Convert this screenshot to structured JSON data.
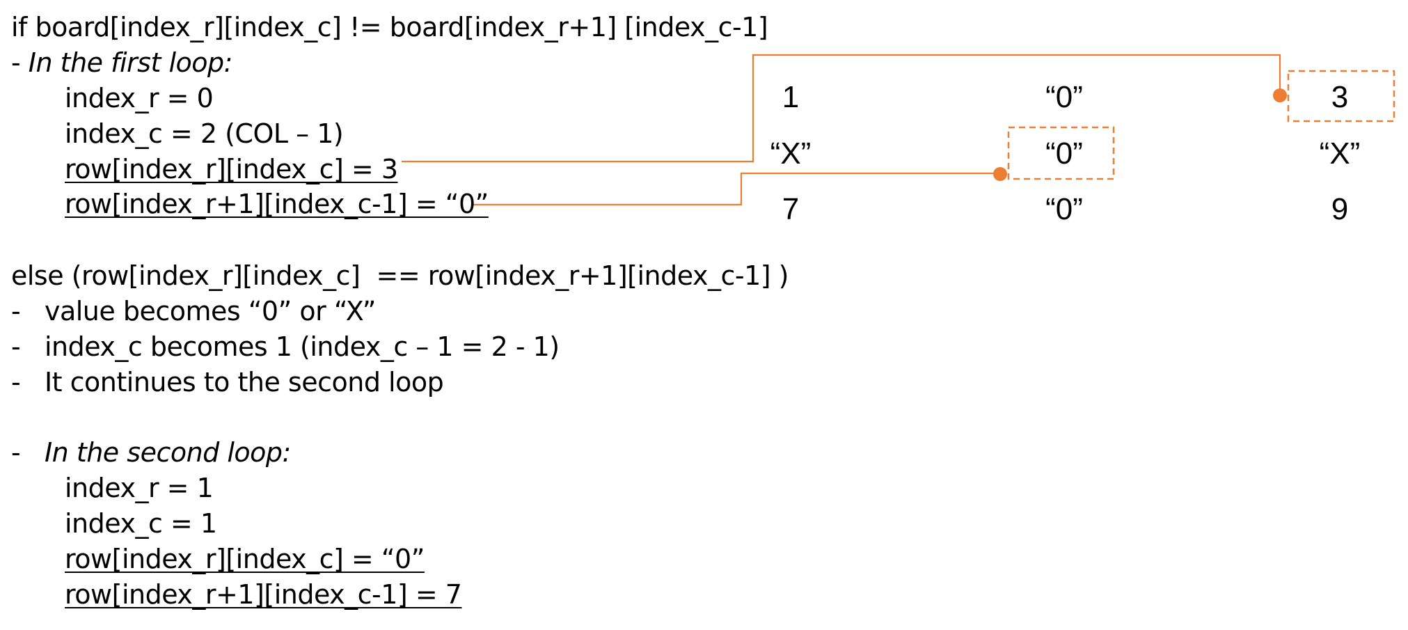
{
  "lines": {
    "cond_if": "if board[index_r][index_c] != board[index_r+1] [index_c-1]",
    "first_loop_dash": "- ",
    "first_loop_label": "In the first loop:",
    "first_index_r": "index_r = 0",
    "first_index_c": "index_c = 2 (COL – 1)",
    "first_row_a": "row[index_r][index_c] = 3",
    "first_row_b": "row[index_r+1][index_c-1] = “0”",
    "else_prefix": "else (",
    "else_cond": "row[index_r][index_c]  == row[index_r+1][index_c-1] )",
    "bullet_1": "-   value becomes “0” or “X”",
    "bullet_2": "-   index_c becomes 1 (index_c – 1 = 2 - 1)",
    "bullet_3": "-   It continues to the second loop",
    "second_loop_dash": "-   ",
    "second_loop_label": "In the second loop:",
    "second_index_r": "index_r = 1",
    "second_index_c": "index_c = 1",
    "second_row_a": "row[index_r][index_c] = “0”",
    "second_row_b": "row[index_r+1][index_c-1] = 7"
  },
  "board": [
    [
      "1",
      "“0”",
      "3"
    ],
    [
      "“X”",
      "“0”",
      "“X”"
    ],
    [
      "7",
      "“0”",
      "9"
    ]
  ],
  "colors": {
    "accent": "#ed7d31",
    "text": "#000000"
  }
}
